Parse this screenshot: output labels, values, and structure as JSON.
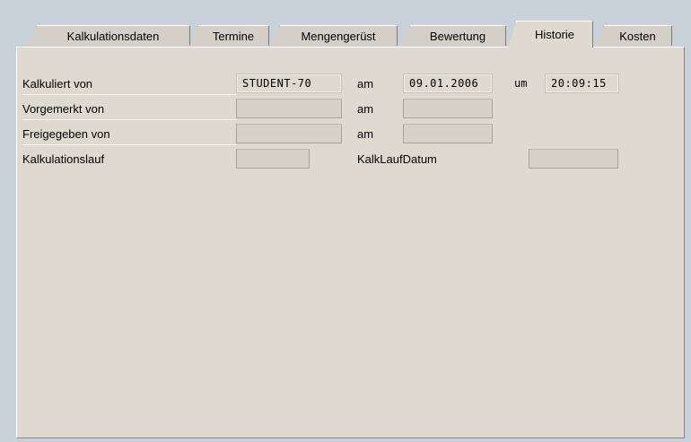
{
  "tabs": [
    {
      "label": "Kalkulationsdaten",
      "active": false
    },
    {
      "label": "Termine",
      "active": false
    },
    {
      "label": "Mengengerüst",
      "active": false
    },
    {
      "label": "Bewertung",
      "active": false
    },
    {
      "label": "Historie",
      "active": true
    },
    {
      "label": "Kosten",
      "active": false
    }
  ],
  "form": {
    "kalkuliert_von": {
      "label": "Kalkuliert von",
      "value": "STUDENT-70",
      "am_label": "am",
      "am_value": "09.01.2006",
      "um_label": "um",
      "um_value": "20:09:15"
    },
    "vorgemerkt_von": {
      "label": "Vorgemerkt von",
      "value": "",
      "am_label": "am",
      "am_value": ""
    },
    "freigegeben_von": {
      "label": "Freigegeben von",
      "value": "",
      "am_label": "am",
      "am_value": ""
    },
    "kalkulationslauf": {
      "label": "Kalkulationslauf",
      "value": "",
      "datum_label": "KalkLaufDatum",
      "datum_value": ""
    }
  }
}
